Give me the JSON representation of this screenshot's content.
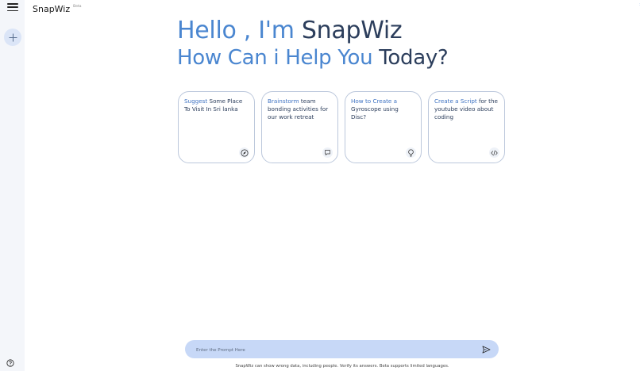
{
  "app": {
    "name": "SnapWiz",
    "badge": "Beta"
  },
  "sidebar": {
    "menu_icon": "hamburger-menu-icon",
    "new_chat_icon": "plus-icon",
    "help_icon": "help-circle-icon"
  },
  "greeting": {
    "line1_highlight": "Hello , I'm ",
    "line1_rest": "SnapWiz",
    "line2_highlight": "How Can i Help You ",
    "line2_rest": "Today?"
  },
  "cards": [
    {
      "highlight": "Suggest ",
      "text": "Some Place To Visit In Sri lanka",
      "icon": "compass-icon"
    },
    {
      "highlight": "Brainstorm ",
      "text": "team bonding activities for our work retreat",
      "icon": "chat-bubble-icon"
    },
    {
      "highlight": "How to Create a ",
      "text": "Gyroscope using Disc?",
      "icon": "lightbulb-icon"
    },
    {
      "highlight": "Create a Script ",
      "text": "for the youtube video about coding",
      "icon": "code-icon"
    }
  ],
  "prompt": {
    "placeholder": "Enter the Prompt Here",
    "send_icon": "send-icon"
  },
  "disclaimer": "SnapWiz can show wrong data, including people. Verify its answers. Beta supports limited languages.",
  "colors": {
    "accent": "#4a86d0",
    "dark_text": "#2c3e5c",
    "prompt_bg": "#c7d8f7",
    "sidebar_bg": "#f4f6fa"
  }
}
